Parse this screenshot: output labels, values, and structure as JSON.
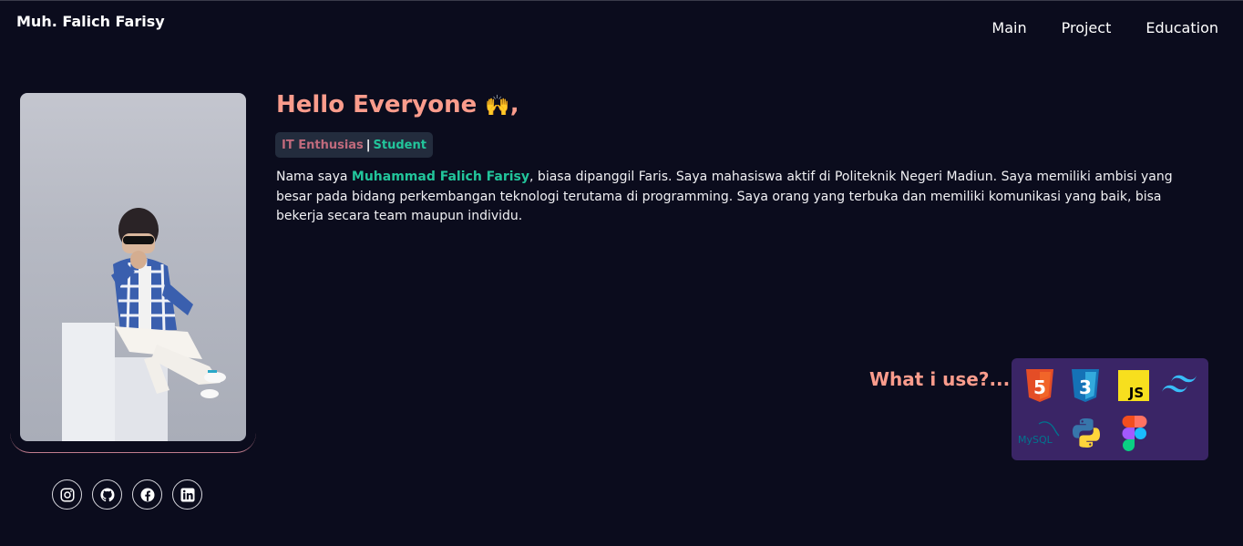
{
  "header": {
    "brand": "Muh. Falich Farisy",
    "nav": [
      {
        "label": "Main"
      },
      {
        "label": "Project"
      },
      {
        "label": "Education"
      }
    ]
  },
  "hero": {
    "greeting": "Hello Everyone",
    "emoji": "🙌",
    "greeting_suffix": ",",
    "badge": {
      "role": "IT Enthusias",
      "separator": "|",
      "status": "Student"
    },
    "bio": {
      "prefix": "Nama saya ",
      "name": "Muhammad Falich Farisy",
      "suffix": ", biasa dipanggil Faris. Saya mahasiswa aktif di Politeknik Negeri Madiun. Saya memiliki ambisi yang besar pada bidang perkembangan teknologi terutama di programming. Saya orang yang terbuka dan memiliki komunikasi yang baik, bisa bekerja secara team maupun individu."
    }
  },
  "socials": [
    {
      "icon": "instagram-icon"
    },
    {
      "icon": "github-icon"
    },
    {
      "icon": "facebook-icon"
    },
    {
      "icon": "linkedin-icon"
    }
  ],
  "tools": {
    "label": "What i use?...",
    "items": [
      {
        "name": "HTML5",
        "text": "5",
        "color": "#e44d26"
      },
      {
        "name": "CSS3",
        "text": "3",
        "color": "#1572b6"
      },
      {
        "name": "JavaScript",
        "text": "JS",
        "color": "#f7df1e"
      },
      {
        "name": "Tailwind",
        "color": "#38bdf8"
      },
      {
        "name": "MySQL",
        "text": "MySQL",
        "color": "#00758f"
      },
      {
        "name": "Python",
        "color": "#3776ab"
      },
      {
        "name": "Figma",
        "color": "#a259ff"
      }
    ]
  }
}
